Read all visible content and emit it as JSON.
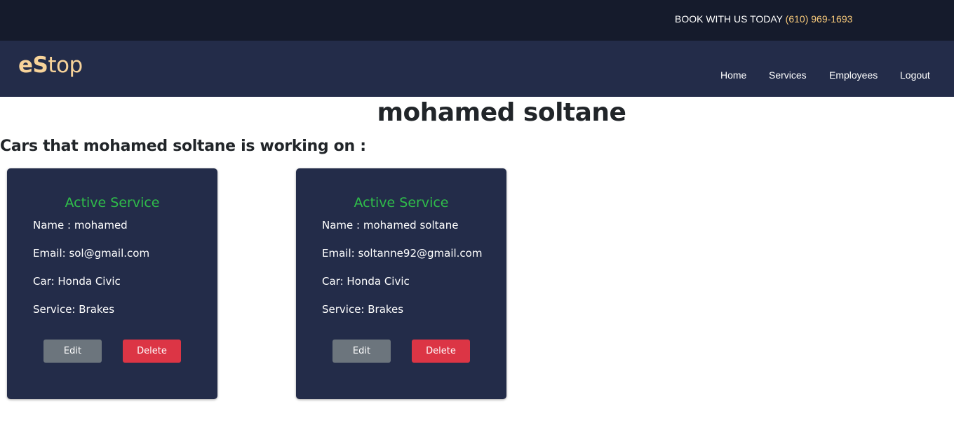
{
  "topbar": {
    "book_text": "BOOK WITH US TODAY",
    "phone": "(610) 969-1693"
  },
  "navbar": {
    "logo_bold": "eS",
    "logo_rest": "top",
    "links": [
      "Home",
      "Services",
      "Employees",
      "Logout"
    ]
  },
  "main": {
    "title": "mohamed soltane",
    "subtitle": "Cars that mohamed soltane is working on :"
  },
  "cards": [
    {
      "title": "Active Service",
      "name": "Name : mohamed",
      "email": "Email: sol@gmail.com",
      "car": "Car: Honda Civic",
      "service": "Service: Brakes",
      "edit_label": "Edit",
      "delete_label": "Delete"
    },
    {
      "title": "Active Service",
      "name": "Name : mohamed soltane",
      "email": "Email: soltanne92@gmail.com",
      "car": "Car: Honda Civic",
      "service": "Service: Brakes",
      "edit_label": "Edit",
      "delete_label": "Delete"
    }
  ],
  "colors": {
    "topbar_bg": "#151b2c",
    "navbar_bg": "#232c49",
    "logo": "#f7d39a",
    "phone": "#f7c97a",
    "card_title": "#2fbd4a",
    "edit_button": "#6c757d",
    "delete_button": "#dc3545"
  }
}
